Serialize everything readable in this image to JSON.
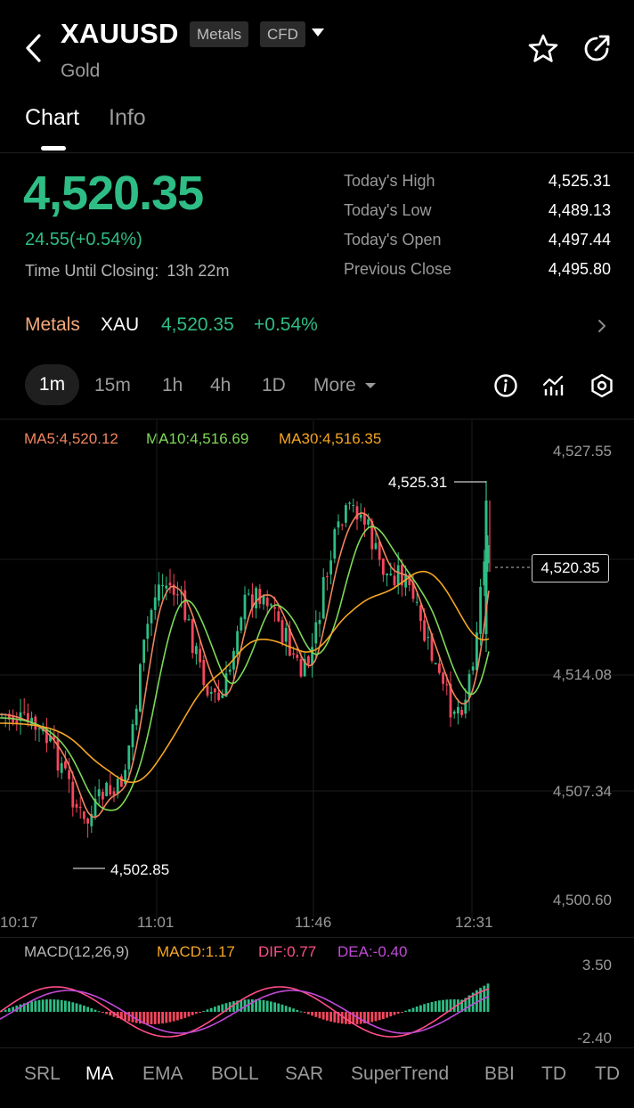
{
  "header": {
    "symbol": "XAUUSD",
    "tags": [
      "Metals",
      "CFD"
    ],
    "subtitle": "Gold",
    "icons": [
      "back-icon",
      "dropdown-caret-icon",
      "star-icon",
      "share-icon"
    ]
  },
  "tabs": [
    {
      "label": "Chart",
      "active": true
    },
    {
      "label": "Info",
      "active": false
    }
  ],
  "quote": {
    "price": "4,520.35",
    "change": "24.55(+0.54%)",
    "time_until_closing_label": "Time Until Closing:",
    "time_until_closing_value": "13h 22m",
    "stats": [
      {
        "label": "Today's High",
        "value": "4,525.31"
      },
      {
        "label": "Today's Low",
        "value": "4,489.13"
      },
      {
        "label": "Today's Open",
        "value": "4,497.44"
      },
      {
        "label": "Previous Close",
        "value": "4,495.80"
      }
    ],
    "up_color": "#2ebd85",
    "down_color": "#f6465d"
  },
  "market_row": {
    "label": "Metals",
    "symbol": "XAU",
    "price": "4,520.35",
    "pct": "+0.54%"
  },
  "timeframes": {
    "items": [
      "1m",
      "15m",
      "1h",
      "4h",
      "1D"
    ],
    "active": "1m",
    "more_label": "More"
  },
  "chart_tools": [
    "info-icon",
    "indicators-icon",
    "settings-icon"
  ],
  "ma_legend": [
    {
      "label": "MA5:4,520.12",
      "color": "#f0845e"
    },
    {
      "label": "MA10:4,516.69",
      "color": "#7ed957"
    },
    {
      "label": "MA30:4,516.35",
      "color": "#f5a623"
    }
  ],
  "chart_data": {
    "type": "candlestick",
    "y_ticks": [
      "4,527.55",
      "4,514.08",
      "4,507.34",
      "4,500.60"
    ],
    "ylim": [
      4500.6,
      4527.55
    ],
    "x_ticks": [
      "10:17",
      "11:01",
      "11:46",
      "12:31"
    ],
    "high_marker": "4,525.31",
    "low_marker": "4,502.85",
    "last_price": "4,520.35",
    "series": [
      {
        "name": "MA5",
        "color": "#f0845e"
      },
      {
        "name": "MA10",
        "color": "#7ed957"
      },
      {
        "name": "MA30",
        "color": "#f5a623"
      }
    ]
  },
  "macd": {
    "title": "MACD(12,26,9)",
    "macd": "MACD:1.17",
    "dif": "DIF:0.77",
    "dea": "DEA:-0.40",
    "macd_color": "#f5a623",
    "dif_color": "#ff4d88",
    "dea_color": "#c04ad6",
    "y_ticks": [
      "3.50",
      "-2.40"
    ]
  },
  "indicators": {
    "items": [
      "SRL",
      "MA",
      "EMA",
      "BOLL",
      "SAR",
      "SuperTrend",
      "BBI",
      "TD",
      "TD"
    ],
    "active": "MA"
  }
}
